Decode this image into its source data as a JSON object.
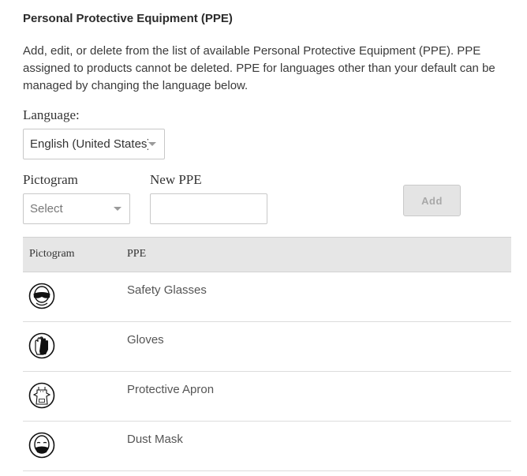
{
  "section": {
    "title": "Personal Protective Equipment (PPE)",
    "description": "Add, edit, or delete from the list of available Personal Protective Equipment (PPE). PPE assigned to products cannot be deleted. PPE for languages other than your default can be managed by changing the language below."
  },
  "language": {
    "label": "Language:",
    "selected": "English (United States)"
  },
  "form": {
    "pictogram_label": "Pictogram",
    "pictogram_placeholder": "Select",
    "new_ppe_label": "New PPE",
    "new_ppe_value": "",
    "add_label": "Add"
  },
  "table": {
    "headers": {
      "pictogram": "Pictogram",
      "ppe": "PPE"
    },
    "rows": [
      {
        "name": "Safety Glasses",
        "icon": "safety-glasses-icon"
      },
      {
        "name": "Gloves",
        "icon": "gloves-icon"
      },
      {
        "name": "Protective Apron",
        "icon": "protective-apron-icon"
      },
      {
        "name": "Dust Mask",
        "icon": "dust-mask-icon"
      }
    ]
  }
}
